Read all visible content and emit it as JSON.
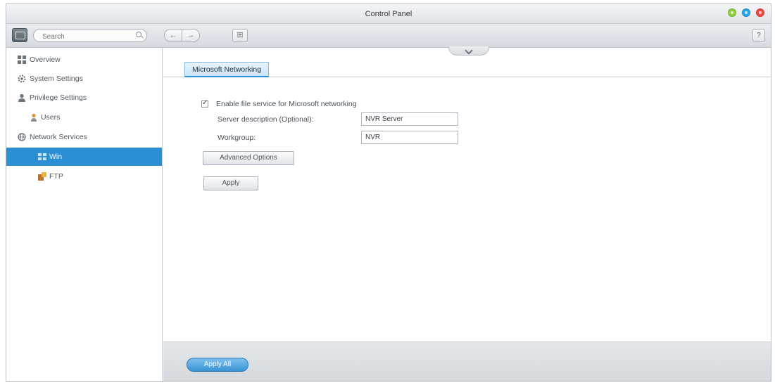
{
  "window": {
    "title": "Control Panel",
    "controls": [
      {
        "name": "minimize",
        "color": "#8fd03a"
      },
      {
        "name": "maximize",
        "color": "#27a6e5"
      },
      {
        "name": "close",
        "color": "#f0483e"
      }
    ]
  },
  "toolbar": {
    "search_placeholder": "Search",
    "back_label": "←",
    "forward_label": "→",
    "grid_label": "⊞",
    "help_label": "?"
  },
  "sidebar": {
    "items": [
      {
        "label": "Overview",
        "icon": "overview-icon"
      },
      {
        "label": "System Settings",
        "icon": "gear-icon"
      },
      {
        "label": "Privilege Settings",
        "icon": "user-icon"
      },
      {
        "label": "Users",
        "icon": "user-icon"
      },
      {
        "label": "Network Services",
        "icon": "globe-icon"
      },
      {
        "label": "Win",
        "icon": "network-share-icon",
        "selected": true
      },
      {
        "label": "FTP",
        "icon": "ftp-icon"
      }
    ]
  },
  "content": {
    "tab_label": "Microsoft Networking",
    "enable_label": "Enable file service for Microsoft networking",
    "enable_checked": true,
    "server_desc_label": "Server description (Optional):",
    "server_desc_value": "NVR Server",
    "workgroup_label": "Workgroup:",
    "workgroup_value": "NVR",
    "advanced_label": "Advanced Options",
    "apply_label": "Apply"
  },
  "footer": {
    "apply_all_label": "Apply All"
  },
  "colors": {
    "accent": "#2d8fd3",
    "apply_all": "#3994d6"
  }
}
